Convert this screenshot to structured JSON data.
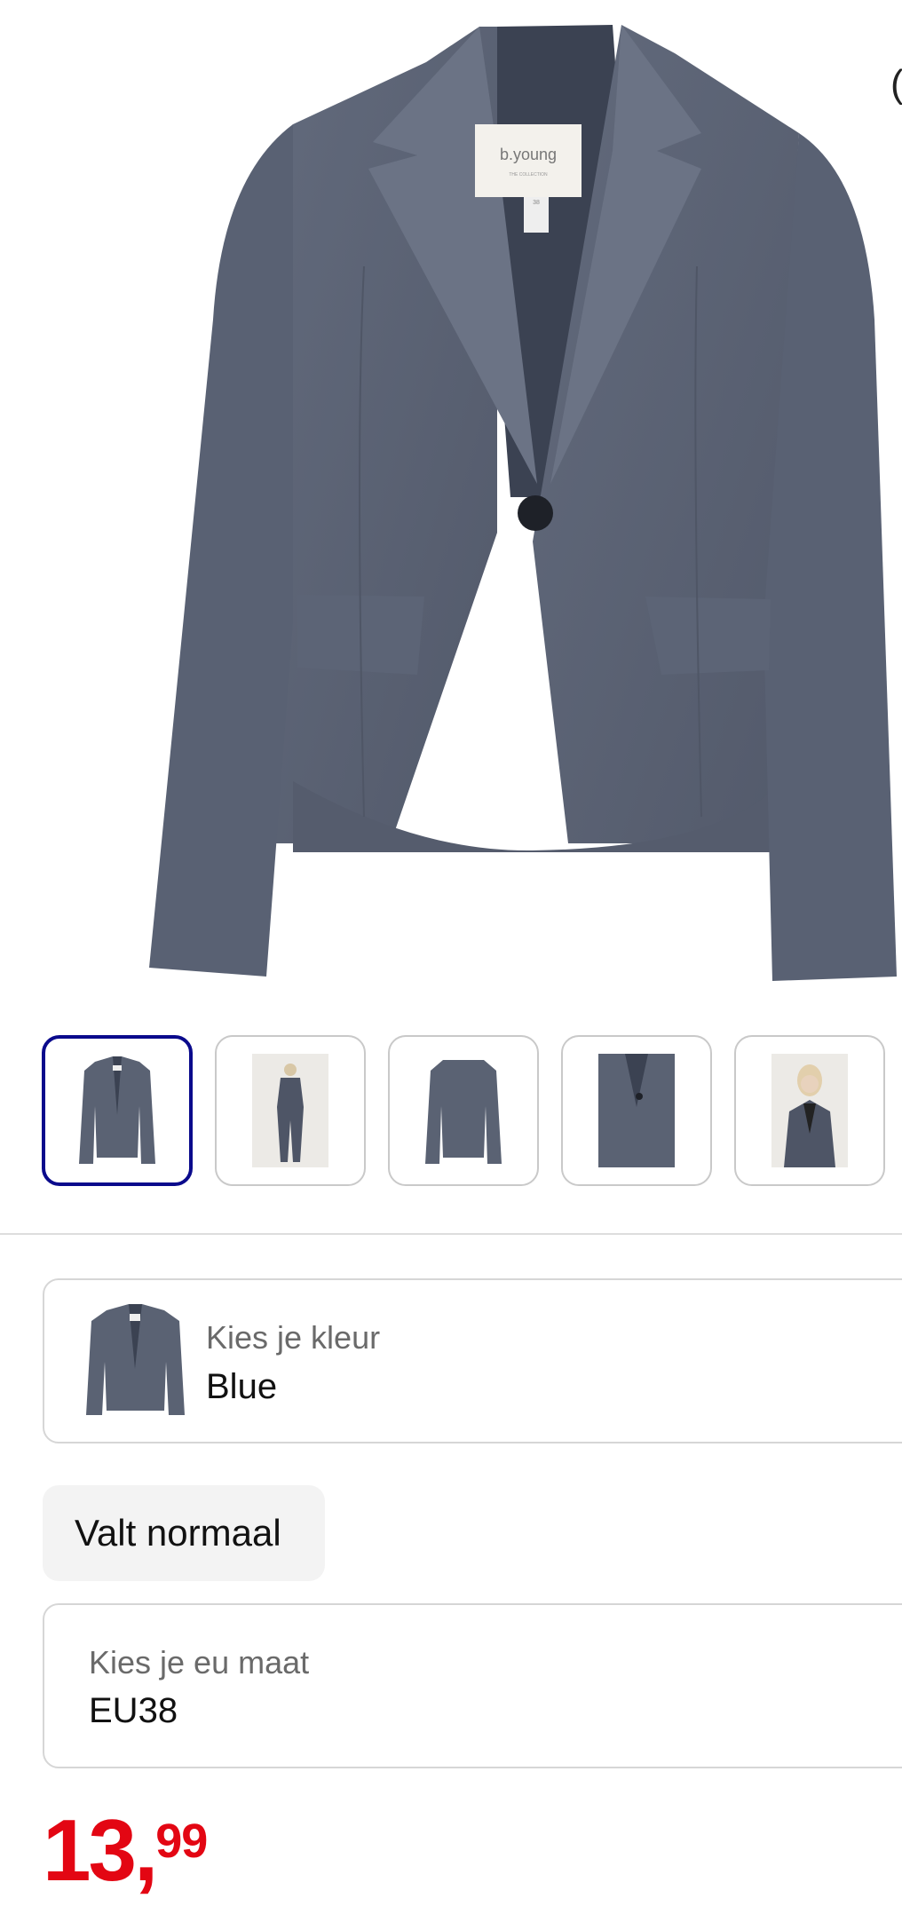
{
  "product": {
    "label_brand": "b.young",
    "label_tagline": "THE COLLECTION",
    "label_size": "38",
    "peek_char": "("
  },
  "thumbnails": [
    {
      "name": "thumb-jacket-front",
      "selected": true
    },
    {
      "name": "thumb-model-full",
      "selected": false
    },
    {
      "name": "thumb-jacket-back",
      "selected": false
    },
    {
      "name": "thumb-jacket-detail",
      "selected": false
    },
    {
      "name": "thumb-model-closeup",
      "selected": false
    }
  ],
  "color_selector": {
    "label": "Kies je kleur",
    "value": "Blue"
  },
  "fit": {
    "label": "Valt normaal"
  },
  "size_selector": {
    "label": "Kies je eu maat",
    "value": "EU38"
  },
  "price": {
    "euros": "13",
    "separator": ",",
    "cents": "99"
  },
  "colors": {
    "jacket": "#5a6273",
    "accent_price": "#e30613",
    "selected_border": "#0a0a8c"
  }
}
